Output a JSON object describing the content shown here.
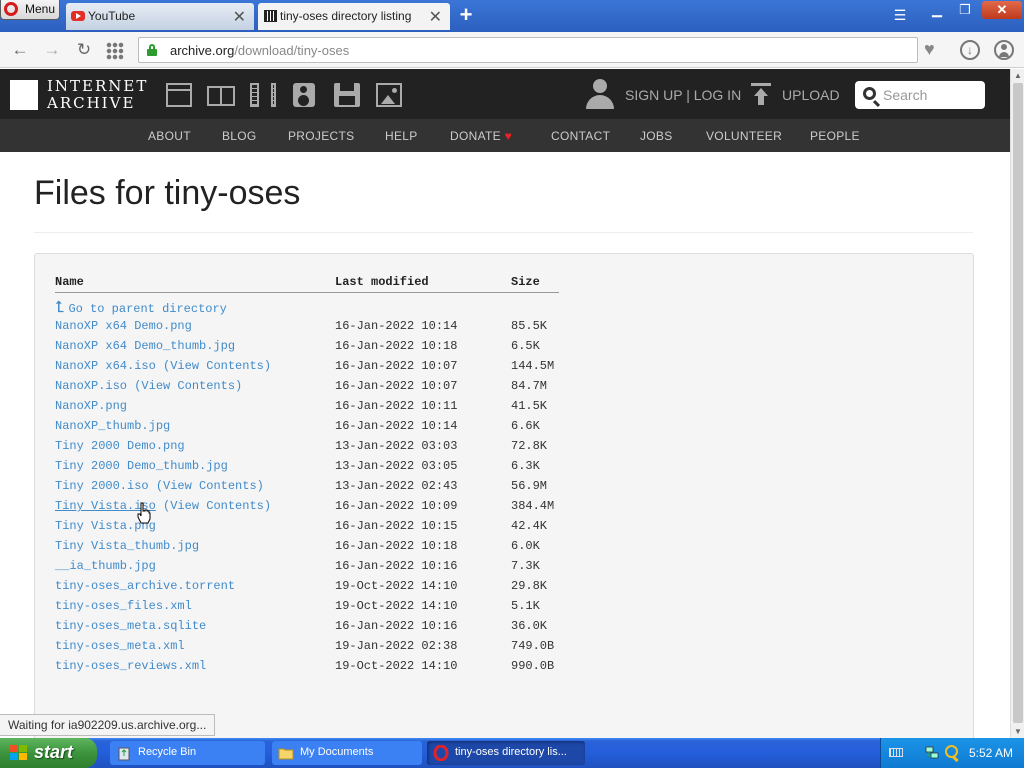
{
  "browser": {
    "menu_label": "Menu",
    "tabs": [
      {
        "title": "YouTube"
      },
      {
        "title": "tiny-oses directory listing"
      }
    ],
    "url_host": "archive.org",
    "url_path": "/download/tiny-oses",
    "status_text": "Waiting for ia902209.us.archive.org..."
  },
  "ia_header": {
    "logo_line1": "INTERNET",
    "logo_line2": "ARCHIVE",
    "signup": "SIGN UP | LOG IN",
    "upload": "UPLOAD",
    "search_placeholder": "Search",
    "nav": [
      "ABOUT",
      "BLOG",
      "PROJECTS",
      "HELP",
      "DONATE",
      "CONTACT",
      "JOBS",
      "VOLUNTEER",
      "PEOPLE"
    ]
  },
  "page": {
    "title": "Files for tiny-oses",
    "columns": {
      "name": "Name",
      "modified": "Last modified",
      "size": "Size"
    },
    "parent_link": "Go to parent directory",
    "view_contents": "(View Contents)",
    "files": [
      {
        "name": "NanoXP x64 Demo.png",
        "modified": "16-Jan-2022 10:14",
        "size": "85.5K",
        "view": false
      },
      {
        "name": "NanoXP x64 Demo_thumb.jpg",
        "modified": "16-Jan-2022 10:18",
        "size": "6.5K",
        "view": false
      },
      {
        "name": "NanoXP x64.iso",
        "modified": "16-Jan-2022 10:07",
        "size": "144.5M",
        "view": true
      },
      {
        "name": "NanoXP.iso",
        "modified": "16-Jan-2022 10:07",
        "size": "84.7M",
        "view": true
      },
      {
        "name": "NanoXP.png",
        "modified": "16-Jan-2022 10:11",
        "size": "41.5K",
        "view": false
      },
      {
        "name": "NanoXP_thumb.jpg",
        "modified": "16-Jan-2022 10:14",
        "size": "6.6K",
        "view": false
      },
      {
        "name": "Tiny 2000 Demo.png",
        "modified": "13-Jan-2022 03:03",
        "size": "72.8K",
        "view": false
      },
      {
        "name": "Tiny 2000 Demo_thumb.jpg",
        "modified": "13-Jan-2022 03:05",
        "size": "6.3K",
        "view": false
      },
      {
        "name": "Tiny 2000.iso",
        "modified": "13-Jan-2022 02:43",
        "size": "56.9M",
        "view": true
      },
      {
        "name": "Tiny Vista.iso",
        "modified": "16-Jan-2022 10:09",
        "size": "384.4M",
        "view": true,
        "hover": true
      },
      {
        "name": "Tiny Vista.png",
        "modified": "16-Jan-2022 10:15",
        "size": "42.4K",
        "view": false
      },
      {
        "name": "Tiny Vista_thumb.jpg",
        "modified": "16-Jan-2022 10:18",
        "size": "6.0K",
        "view": false
      },
      {
        "name": "__ia_thumb.jpg",
        "modified": "16-Jan-2022 10:16",
        "size": "7.3K",
        "view": false
      },
      {
        "name": "tiny-oses_archive.torrent",
        "modified": "19-Oct-2022 14:10",
        "size": "29.8K",
        "view": false
      },
      {
        "name": "tiny-oses_files.xml",
        "modified": "19-Oct-2022 14:10",
        "size": "5.1K",
        "view": false
      },
      {
        "name": "tiny-oses_meta.sqlite",
        "modified": "16-Jan-2022 10:16",
        "size": "36.0K",
        "view": false
      },
      {
        "name": "tiny-oses_meta.xml",
        "modified": "19-Jan-2022 02:38",
        "size": "749.0B",
        "view": false
      },
      {
        "name": "tiny-oses_reviews.xml",
        "modified": "19-Oct-2022 14:10",
        "size": "990.0B",
        "view": false
      }
    ]
  },
  "taskbar": {
    "start_label": "start",
    "tasks": [
      {
        "label": "Recycle Bin"
      },
      {
        "label": "My Documents"
      },
      {
        "label": "tiny-oses directory lis..."
      }
    ],
    "clock": "5:52 AM"
  },
  "colors": {
    "link": "#428bca",
    "ia_header_bg": "#222222",
    "ia_nav_bg": "#333333",
    "donate_heart": "#ee2222"
  }
}
